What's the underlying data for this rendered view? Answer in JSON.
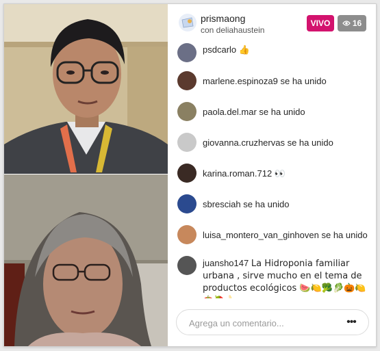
{
  "header": {
    "host_username": "prismaong",
    "guest_line": "con deliahaustein",
    "live_label": "VIVO",
    "viewer_count": "16"
  },
  "comments": [
    {
      "user": "psdcarlo",
      "text": "👍",
      "avatar_color": "#6b6f86"
    },
    {
      "user": "marlene.espinoza9",
      "text": "se ha unido",
      "avatar_color": "#5b3a2e"
    },
    {
      "user": "paola.del.mar",
      "text": "se ha unido",
      "avatar_color": "#8a8062"
    },
    {
      "user": "giovanna.cruzhervas",
      "text": "se ha unido",
      "avatar_color": "#c9c9c9"
    },
    {
      "user": "karina.roman.712",
      "text": "👀",
      "avatar_color": "#3a2a24"
    },
    {
      "user": "sbresciah",
      "text": "se ha unido",
      "avatar_color": "#2b4a8f"
    },
    {
      "user": "luisa_montero_van_ginhoven",
      "text": "se ha unido",
      "avatar_color": "#c7885c"
    },
    {
      "user": "juansho147",
      "text": "La Hidroponia familiar urbana , sirve mucho en el tema de productos ecológicos 🍉🍋🥦🥬🎃🍋🍅🍓🍌",
      "avatar_color": "#555555"
    }
  ],
  "input": {
    "placeholder": "Agrega un comentario..."
  },
  "more_label": "•••"
}
